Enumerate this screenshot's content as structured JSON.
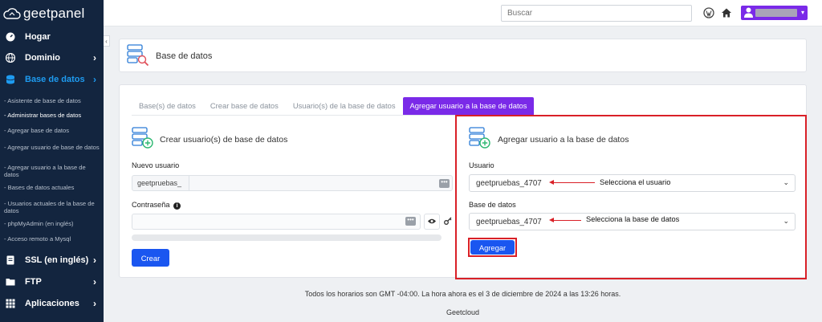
{
  "brand": {
    "name": "geetpanel"
  },
  "sidebar": {
    "items": [
      {
        "label": "Hogar",
        "icon": "gauge-icon"
      },
      {
        "label": "Dominio",
        "icon": "globe-icon"
      },
      {
        "label": "Base de datos",
        "icon": "database-icon",
        "active": true
      },
      {
        "label": "SSL (en inglés)",
        "icon": "ssl-icon"
      },
      {
        "label": "FTP",
        "icon": "folder-icon"
      },
      {
        "label": "Aplicaciones",
        "icon": "grid-icon"
      }
    ],
    "subitems": [
      "- Asistente de base de datos",
      "- Administrar bases de datos",
      "- Agregar base de datos",
      "- Agregar usuario de base de datos",
      "- Agregar usuario a la base de datos",
      "- Bases de datos actuales",
      "- Usuarios actuales de la base de datos",
      "- phpMyAdmin (en inglés)",
      "- Acceso remoto a Mysql"
    ],
    "collapse_glyph": "‹"
  },
  "topbar": {
    "search_placeholder": "Buscar",
    "user_caret": "▾"
  },
  "header": {
    "title": "Base de datos"
  },
  "tabs": [
    "Base(s) de datos",
    "Crear base de datos",
    "Usuario(s) de la base de datos",
    "Agregar usuario a la base de datos"
  ],
  "left_panel": {
    "title": "Crear usuario(s) de base de datos",
    "new_user_label": "Nuevo usuario",
    "new_user_prefix": "geetpruebas_",
    "password_label": "Contraseña",
    "password_info_glyph": "i",
    "dots_glyph": "•••",
    "create_button": "Crear"
  },
  "right_panel": {
    "title": "Agregar usuario a la base de datos",
    "user_label": "Usuario",
    "user_value": "geetpruebas_4707",
    "user_annotation": "Selecciona el usuario",
    "db_label": "Base de datos",
    "db_value": "geetpruebas_4707",
    "db_annotation": "Selecciona la base de datos",
    "add_button": "Agregar",
    "chevron_glyph": "⌄"
  },
  "footer": {
    "time_notice": "Todos los horarios son GMT -04:00. La hora ahora es el 3 de diciembre de 2024 a las 13:26 horas.",
    "company": "Geetcloud"
  },
  "colors": {
    "sidebar_bg": "#13253f",
    "accent_purple": "#7a2ae8",
    "primary_blue": "#1a56f0",
    "annotation_red": "#d92027",
    "active_nav": "#1e9bf0"
  }
}
